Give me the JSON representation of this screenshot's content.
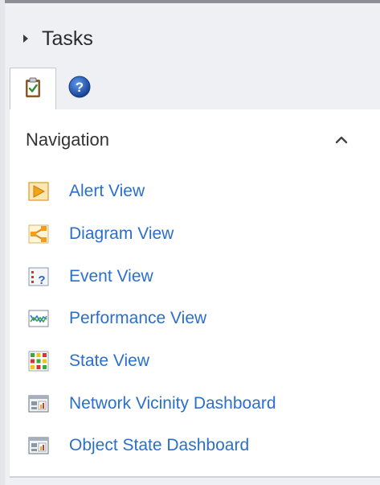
{
  "tasks": {
    "title": "Tasks",
    "chevron_icon": "chevron-right-icon"
  },
  "tabs": [
    {
      "icon": "clipboard-check-icon",
      "active": true
    },
    {
      "icon": "help-circle-icon",
      "active": false
    }
  ],
  "navigation": {
    "title": "Navigation",
    "collapse_icon": "chevron-up-icon",
    "items": [
      {
        "label": "Alert View",
        "icon": "alert-view-icon"
      },
      {
        "label": "Diagram View",
        "icon": "diagram-view-icon"
      },
      {
        "label": "Event View",
        "icon": "event-view-icon"
      },
      {
        "label": "Performance View",
        "icon": "performance-view-icon"
      },
      {
        "label": "State View",
        "icon": "state-view-icon"
      },
      {
        "label": "Network Vicinity Dashboard",
        "icon": "dashboard-icon"
      },
      {
        "label": "Object State Dashboard",
        "icon": "dashboard-icon"
      }
    ]
  },
  "colors": {
    "link": "#2b6fcc",
    "panel_bg": "#eef0f3",
    "help_blue": "#1e56b0"
  }
}
